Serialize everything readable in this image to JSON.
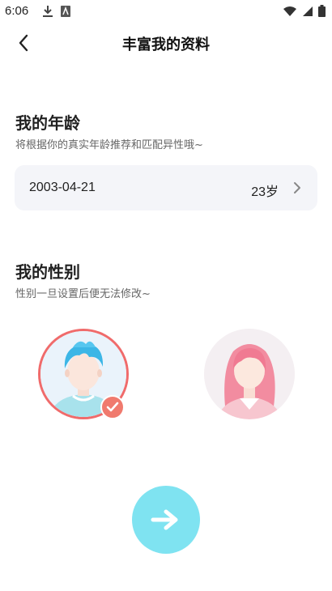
{
  "status_bar": {
    "time": "6:06",
    "left_icons": [
      "download-icon",
      "app-notification-icon"
    ],
    "right_icons": [
      "wifi-icon",
      "signal-icon",
      "battery-icon"
    ]
  },
  "nav": {
    "title": "丰富我的资料",
    "back_icon": "back-arrow-icon"
  },
  "age_section": {
    "title": "我的年龄",
    "subtitle": "将根据你的真实年龄推荐和匹配异性哦~",
    "birthday": "2003-04-21",
    "age": "23岁",
    "chevron_icon": "chevron-right-icon"
  },
  "gender_section": {
    "title": "我的性别",
    "subtitle": "性别一旦设置后便无法修改~",
    "options": [
      {
        "name": "male",
        "selected": true
      },
      {
        "name": "female",
        "selected": false
      }
    ],
    "selected_color": "#f06b6b"
  },
  "next_button": {
    "icon": "arrow-right-icon",
    "color": "#7fe3f1"
  }
}
